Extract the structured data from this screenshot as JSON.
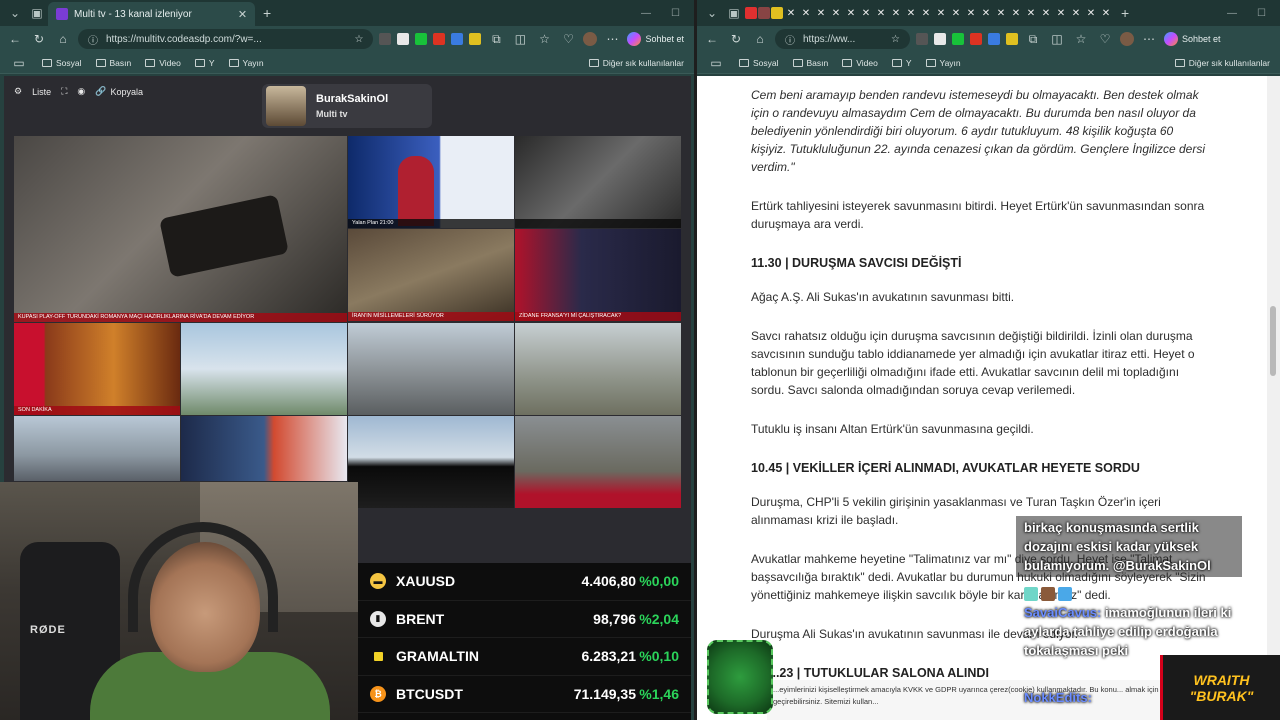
{
  "left": {
    "tab_title": "Multi tv - 13 kanal izleniyor",
    "url": "https://multitv.codeasdp.com/?w=...",
    "copilot_label": "Sohbet et",
    "bookmarks": [
      "Sosyal",
      "Basın",
      "Video",
      "Y",
      "Yayın"
    ],
    "bookmarks_right": "Diğer sık kullanılanlar",
    "controls": {
      "list": "Liste",
      "copy": "Kopyala"
    },
    "profile": {
      "name": "BurakSakinOl",
      "sub": "Multi tv"
    },
    "tiles": [
      {
        "label": "KUPASI PLAY-OFF TURUNDAKİ ROMANYA MAÇI HAZIRLIKLARINA RİVA'DA DEVAM EDİYOR"
      },
      {
        "label": "Yalan Plan 21:00"
      },
      {
        "label": ""
      },
      {
        "label": "İRAN'IN MİSİLLEMELERİ SÜRÜYOR"
      },
      {
        "label": "ZİDANE FRANSA'YI Mİ ÇALIŞTIRACAK?"
      },
      {
        "label": "SON DAKİKA"
      },
      {
        "label": ""
      },
      {
        "label": ""
      },
      {
        "label": ""
      },
      {
        "label": ""
      },
      {
        "label": ""
      },
      {
        "label": ""
      },
      {
        "label": ""
      }
    ]
  },
  "webcam": {
    "chair_text": "RØDE"
  },
  "ticker": [
    {
      "name": "XAUUSD",
      "price": "4.406,80",
      "change": "%0,00",
      "icon": "gold-icon",
      "color": "#f5c542"
    },
    {
      "name": "BRENT",
      "price": "98,796",
      "change": "%2,04",
      "icon": "oil-icon",
      "color": "#e8e8e8"
    },
    {
      "name": "GRAMALTIN",
      "price": "6.283,21",
      "change": "%0,10",
      "icon": "gold-bar-icon",
      "color": "#f2d227"
    },
    {
      "name": "BTCUSDT",
      "price": "71.149,35",
      "change": "%1,46",
      "icon": "bitcoin-icon",
      "color": "#f7931a"
    }
  ],
  "right": {
    "url": "https://ww...",
    "copilot_label": "Sohbet et",
    "bookmarks": [
      "Sosyal",
      "Basın",
      "Video",
      "Y",
      "Yayın"
    ],
    "bookmarks_right": "Diğer sık kullanılanlar",
    "article": {
      "quote": "Cem beni aramayıp benden randevu istemeseydi bu olmayacaktı. Ben destek olmak için o randevuyu almasaydım Cem de olmayacaktı. Bu durumda ben nasıl oluyor da belediyenin yönlendirdiği biri oluyorum. 6 aydır tutukluyum. 48 kişilik koğuşta 60 kişiyiz. Tutukluluğunun 22. ayında cenazesi çıkan da gördüm. Gençlere İngilizce dersi verdim.\"",
      "p1": "Ertürk tahliyesini isteyerek savunmasını bitirdi. Heyet Ertürk'ün savunmasından sonra duruşmaya ara verdi.",
      "h1": "11.30 | DURUŞMA SAVCISI DEĞİŞTİ",
      "p2": "Ağaç A.Ş. Ali Sukas'ın avukatının savunması bitti.",
      "p3": "Savcı rahatsız olduğu için duruşma savcısının değiştiği bildirildi. İzinli olan duruşma savcısının sunduğu tablo iddianamede yer almadığı için avukatlar itiraz etti. Heyet o tablonun bir geçerliliği olmadığını ifade etti. Avukatlar savcının delil mi topladığını sordu. Savcı salonda olmadığından soruya cevap verilemedi.",
      "p4": "Tutuklu iş insanı Altan Ertürk'ün savunmasına geçildi.",
      "h2": "10.45 | VEKİLLER İÇERİ ALINMADI, AVUKATLAR HEYETE SORDU",
      "p5": "Duruşma, CHP'li 5 vekilin girişinin yasaklanması ve Turan Taşkın Özer'in içeri alınmaması krizi ile başladı.",
      "p6": "Avukatlar mahkeme heyetine \"Talimatınız var mı\" diye sordu. Heyet ise \"Talimat başsavcılığa bıraktık\" dedi. Avukatlar bu durumun hukuki olmadığını söyleyerek \"Sizin yönettiğiniz mahkemeye ilişkin savcılık böyle bir karar alamaz\" dedi.",
      "p7": "Duruşma Ali Sukas'ın avukatının savunması ile devam ediyor.",
      "h3": "...23 | TUTUKLULAR SALONA ALINDI",
      "cookie": "...eyimlerinizi kişiselleştirmek amacıyla KVKK ve GDPR uyarınca çerez(cookie) kullanmaktadır. Bu konu... almak için Çerez politikamızı gözden geçirebilirsiniz. Sitemizi kullan..."
    }
  },
  "chat": {
    "msg1": "birkaç konuşmasında sertlik dozajını eskisi kadar yüksek bulamıyorum. @BurakSakinOl",
    "user2": "SavaiCavus:",
    "msg2": " imamoğlunun ileri ki aylarda tahliye edilip erdoğanla tokalaşması peki",
    "user3": "NokkEdits:"
  },
  "overlay": {
    "brand1": "WRAITH",
    "brand2": "\"BURAK\""
  },
  "colors": {
    "accent_green": "#2bd45a",
    "window_frame": "#26413f"
  }
}
